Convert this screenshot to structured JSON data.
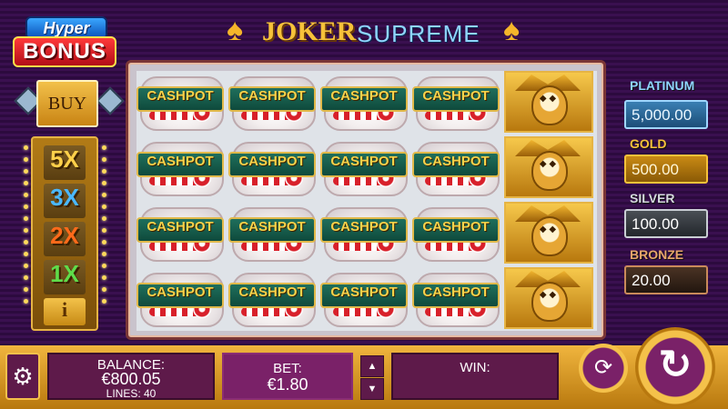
{
  "logo": {
    "hyper": "Hyper",
    "bonus": "BONUS"
  },
  "title": {
    "joker": "JOKER",
    "supreme": "SUPREME"
  },
  "buy_label": "BUY",
  "multipliers": [
    "5X",
    "3X",
    "2X",
    "1X"
  ],
  "info_label": "i",
  "reels": {
    "cashpot_label": "CASHPOT",
    "grid": [
      [
        "cashpot",
        "cashpot",
        "cashpot",
        "cashpot",
        "joker"
      ],
      [
        "cashpot",
        "cashpot",
        "cashpot",
        "cashpot",
        "joker"
      ],
      [
        "cashpot",
        "cashpot",
        "cashpot",
        "cashpot",
        "joker"
      ],
      [
        "cashpot",
        "cashpot",
        "cashpot",
        "cashpot",
        "joker"
      ]
    ]
  },
  "jackpots": {
    "platinum": {
      "label": "PLATINUM",
      "value": "5,000.00"
    },
    "gold": {
      "label": "GOLD",
      "value": "500.00"
    },
    "silver": {
      "label": "SILVER",
      "value": "100.00"
    },
    "bronze": {
      "label": "BRONZE",
      "value": "20.00"
    }
  },
  "footer": {
    "balance_label": "BALANCE:",
    "balance_value": "€800.05",
    "lines": "LINES: 40",
    "bet_label": "BET:",
    "bet_value": "€1.80",
    "win_label": "WIN:"
  },
  "icons": {
    "settings": "gear-icon",
    "autoplay": "autoplay-icon",
    "spin": "spin-icon",
    "up": "arrow-up-icon",
    "down": "arrow-down-icon"
  }
}
